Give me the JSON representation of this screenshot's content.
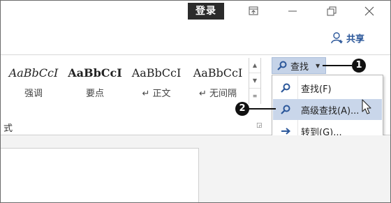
{
  "titlebar": {
    "login_label": "登录",
    "controls": [
      {
        "name": "ribbon-display-options-icon"
      },
      {
        "name": "minimize-icon"
      },
      {
        "name": "restore-icon"
      },
      {
        "name": "close-icon"
      }
    ]
  },
  "share": {
    "label": "共享",
    "icon": "person-add-icon"
  },
  "styles": {
    "items": [
      {
        "sample": "AaBbCcI",
        "name": "强调"
      },
      {
        "sample": "AaBbCcI",
        "name": "要点"
      },
      {
        "sample": "AaBbCcI",
        "name": "↵ 正文"
      },
      {
        "sample": "AaBbCcI",
        "name": "↵ 无间隔"
      }
    ],
    "group_label": "式"
  },
  "find": {
    "button_label": "查找",
    "menu": [
      {
        "label": "查找(F)",
        "icon": "search-icon"
      },
      {
        "label": "高级查找(A)...",
        "icon": "search-icon"
      },
      {
        "label": "转到(G)...",
        "icon": "arrow-right-icon"
      }
    ]
  },
  "callouts": {
    "one": "1",
    "two": "2"
  },
  "colors": {
    "accent": "#2b579a",
    "hover": "#c9d6ea",
    "button_active": "#c5d3e8"
  }
}
